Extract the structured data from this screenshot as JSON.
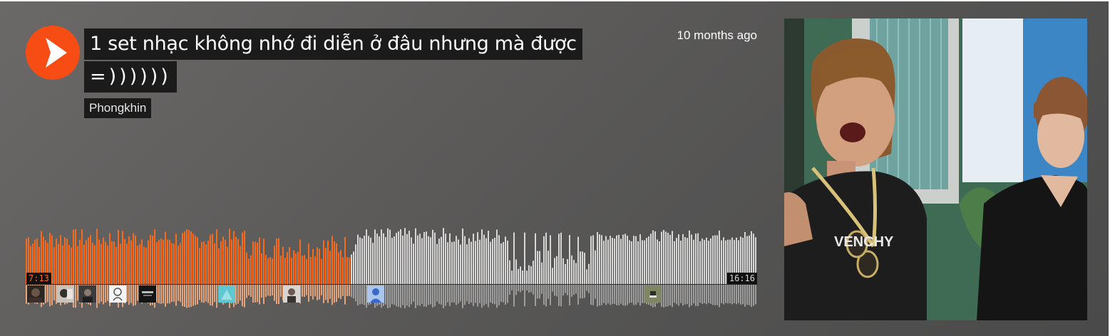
{
  "track": {
    "title_line1": "1 set nhạc không nhớ đi diễn ở đâu nhưng mà được",
    "title_line2": "=))))))",
    "artist": "Phongkhin",
    "posted": "10 months ago"
  },
  "player": {
    "current_time": "7:13",
    "total_time": "16:16",
    "progress": 0.443,
    "played_color": "#f76b1c",
    "unplayed_color": "#d7d7d7",
    "brand_color": "#f74c14"
  },
  "icons": {
    "play": "play-icon"
  },
  "comments": {
    "avatar_count": 11
  }
}
